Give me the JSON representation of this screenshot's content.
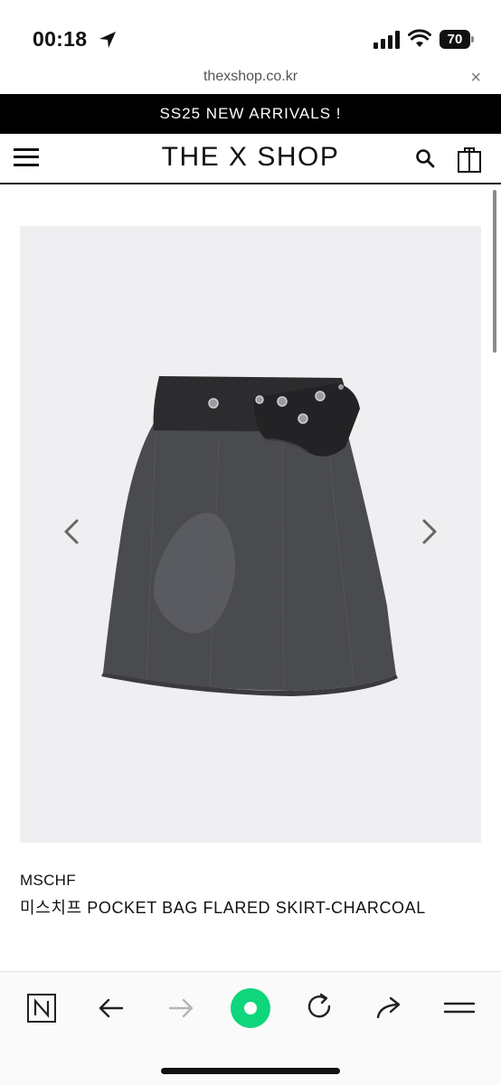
{
  "status_bar": {
    "time": "00:18",
    "battery": "70",
    "icons": [
      "location-icon",
      "signal-icon",
      "wifi-icon",
      "battery-icon"
    ]
  },
  "browser": {
    "url": "thexshop.co.kr",
    "close_glyph": "×"
  },
  "banner": {
    "text": "SS25 NEW ARRIVALS !"
  },
  "header": {
    "logo": "THE X SHOP",
    "icons": [
      "menu-icon",
      "search-icon",
      "shopping-bag-icon"
    ]
  },
  "product": {
    "brand": "MSCHF",
    "name": "미스치프 POCKET BAG FLARED SKIRT-CHARCOAL",
    "image_alt": "charcoal pocket bag flared skirt",
    "gallery_controls": [
      "chevron-left-icon",
      "chevron-right-icon"
    ]
  },
  "toolbar": {
    "items": [
      "naver-icon",
      "back-arrow-icon",
      "forward-arrow-icon",
      "green-dot-icon",
      "refresh-icon",
      "share-icon",
      "menu-lines-icon"
    ]
  },
  "colors": {
    "banner_bg": "#000000",
    "image_bg": "#efeff2",
    "skirt": "#4a4b4f",
    "waistband": "#2c2c2e",
    "accent_green": "#0fd67c"
  }
}
